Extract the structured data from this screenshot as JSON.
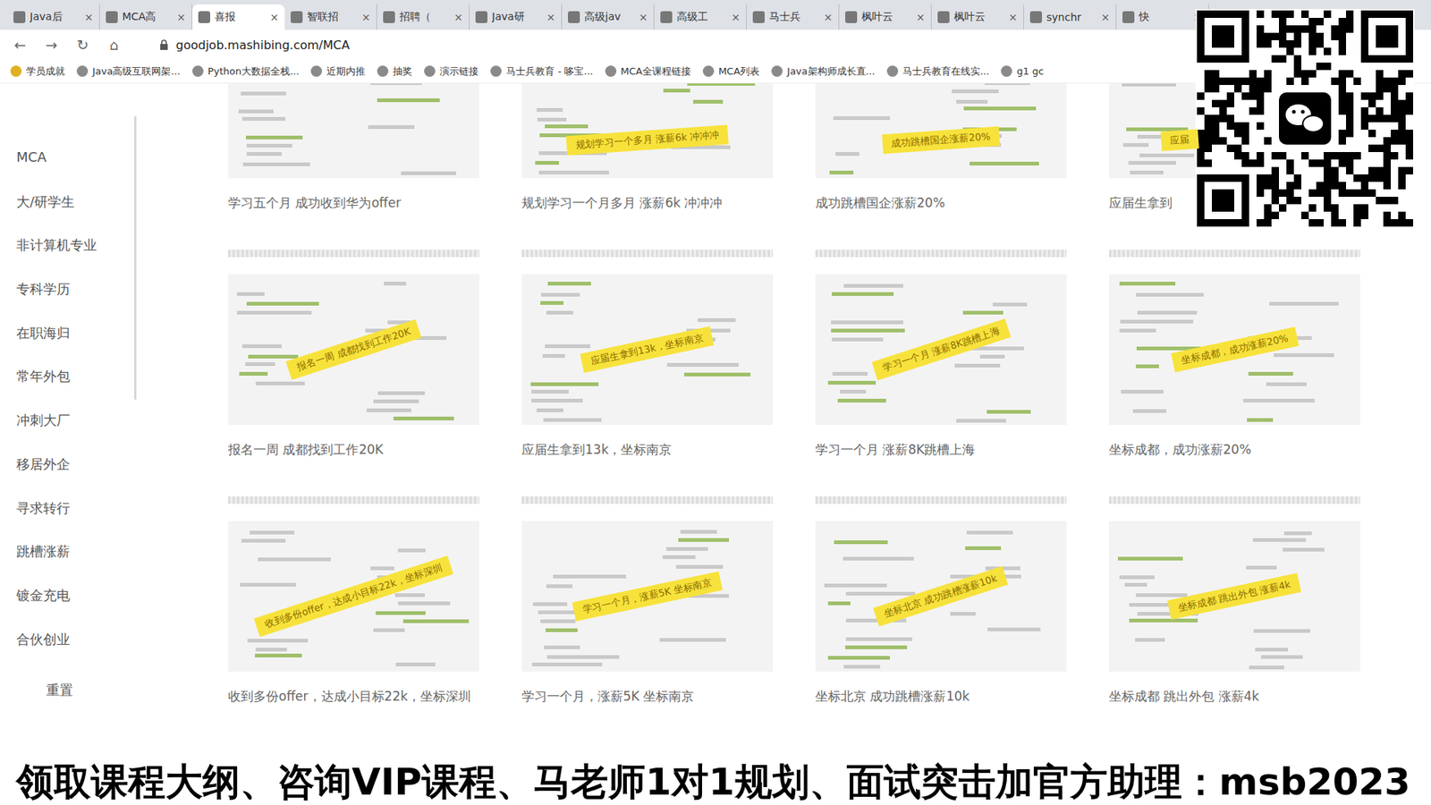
{
  "browser": {
    "tabs": [
      {
        "label": "Java后",
        "close": "×",
        "selected": false
      },
      {
        "label": "MCA高",
        "close": "×",
        "selected": false
      },
      {
        "label": "喜报",
        "close": "×",
        "selected": true
      },
      {
        "label": "智联招",
        "close": "×",
        "selected": false
      },
      {
        "label": "招聘（",
        "close": "×",
        "selected": false
      },
      {
        "label": "Java研",
        "close": "×",
        "selected": false
      },
      {
        "label": "高级jav",
        "close": "×",
        "selected": false
      },
      {
        "label": "高级工",
        "close": "×",
        "selected": false
      },
      {
        "label": "马士兵",
        "close": "×",
        "selected": false
      },
      {
        "label": "枫叶云",
        "close": "×",
        "selected": false
      },
      {
        "label": "枫叶云",
        "close": "×",
        "selected": false
      },
      {
        "label": "synchr",
        "close": "×",
        "selected": false
      },
      {
        "label": "快",
        "close": "×",
        "selected": false
      }
    ],
    "nav": [
      "←",
      "→",
      "↻",
      "⌂"
    ],
    "url": "goodjob.mashibing.com/MCA",
    "bookmarks": [
      "学员成就",
      "Java高级互联网架...",
      "Python大数据全栈...",
      "近期内推",
      "抽奖",
      "演示链接",
      "马士兵教育 - 哆宝...",
      "MCA全课程链接",
      "MCA列表",
      "Java架构师成长直...",
      "马士兵教育在线实...",
      "g1 gc"
    ]
  },
  "sidebar": {
    "items": [
      "MCA",
      "大/研学生",
      "非计算机专业",
      "专科学历",
      "在职海归",
      "常年外包",
      "冲刺大厂",
      "移居外企",
      "寻求转行",
      "跳槽涨薪",
      "镀金充电",
      "合伙创业"
    ],
    "reset": "重置"
  },
  "cards": [
    {
      "caption": "学习五个月 成功收到华为offer"
    },
    {
      "caption": "规划学习一个月多月 涨薪6k 冲冲冲",
      "tag": "规划学习一个多月 涨薪6k 冲冲冲"
    },
    {
      "caption": "成功跳槽国企涨薪20%",
      "tag": "成功跳槽国企涨薪20%"
    },
    {
      "caption": "应届生拿到",
      "tag": "应届"
    },
    {
      "caption": "报名一周 成都找到工作20K",
      "tag": "报名一周 成都找到工作20K"
    },
    {
      "caption": "应届生拿到13k，坐标南京",
      "tag": "应届生拿到13k，坐标南京"
    },
    {
      "caption": "学习一个月 涨薪8K跳槽上海",
      "tag": "学习一个月 涨薪8K跳槽上海"
    },
    {
      "caption": "坐标成都，成功涨薪20%",
      "tag": "坐标成都，成功涨薪20%"
    },
    {
      "caption": "收到多份offer，达成小目标22k，坐标深圳",
      "tag": "收到多份offer，达成小目标22k，坐标深圳"
    },
    {
      "caption": "学习一个月，涨薪5K 坐标南京",
      "tag": "学习一个月，涨薪5K 坐标南京"
    },
    {
      "caption": "坐标北京 成功跳槽涨薪10k",
      "tag": "坐标北京 成功跳槽涨薪10k"
    },
    {
      "caption": "坐标成都 跳出外包 涨薪4k",
      "tag": "坐标成都 跳出外包 涨薪4k"
    }
  ],
  "banner": "领取课程大纲、咨询VIP课程、马老师1对1规划、面试突击加官方助理：msb2023"
}
